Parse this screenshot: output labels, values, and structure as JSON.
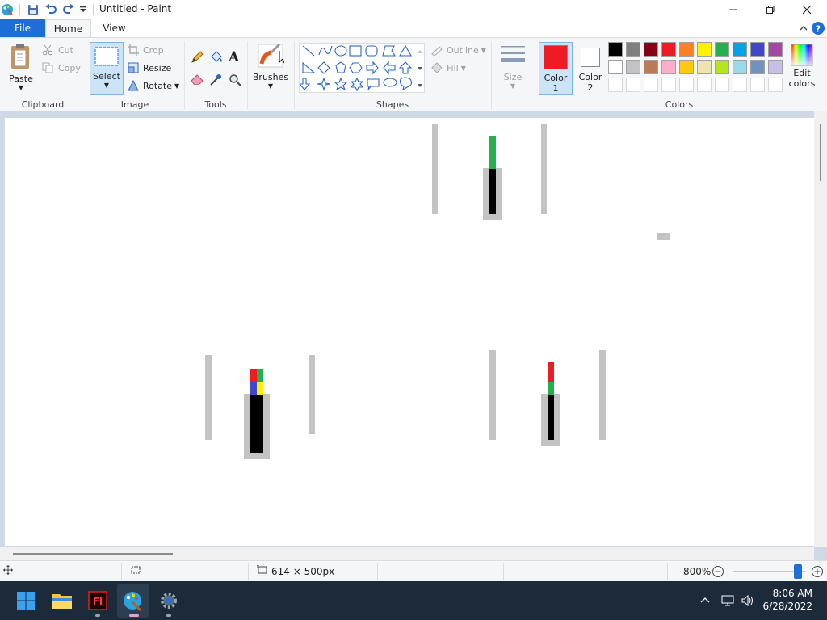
{
  "window": {
    "title": "Untitled - Paint"
  },
  "menu": {
    "file": "File",
    "home": "Home",
    "view": "View"
  },
  "ribbon": {
    "clipboard": {
      "paste": "Paste",
      "cut": "Cut",
      "copy": "Copy",
      "group": "Clipboard"
    },
    "image": {
      "select": "Select",
      "crop": "Crop",
      "resize": "Resize",
      "rotate": "Rotate",
      "group": "Image"
    },
    "tools": {
      "group": "Tools",
      "text_tool_glyph": "A"
    },
    "brushes": {
      "label": "Brushes"
    },
    "shapes": {
      "outline": "Outline",
      "fill": "Fill",
      "group": "Shapes"
    },
    "size": {
      "label": "Size"
    },
    "colors": {
      "color1": "Color",
      "color1_num": "1",
      "color2": "Color",
      "color2_num": "2",
      "edit": "Edit",
      "edit2": "colors",
      "group": "Colors",
      "color1_value": "#ed1c24",
      "color2_value": "#ffffff",
      "palette_row1": [
        "#000000",
        "#7f7f7f",
        "#880015",
        "#ed1c24",
        "#ff7f27",
        "#fff200",
        "#22b14c",
        "#00a2e8",
        "#3f48cc",
        "#a349a4"
      ],
      "palette_row2": [
        "#ffffff",
        "#c3c3c3",
        "#b97a57",
        "#ffaec9",
        "#ffc90e",
        "#efe4b0",
        "#b5e61d",
        "#99d9ea",
        "#7092be",
        "#c8bfe7"
      ]
    }
  },
  "status": {
    "dimensions": "614 × 500px",
    "zoom": "800%"
  },
  "taskbar": {
    "time": "8:06 AM",
    "date": "6/28/2022"
  }
}
